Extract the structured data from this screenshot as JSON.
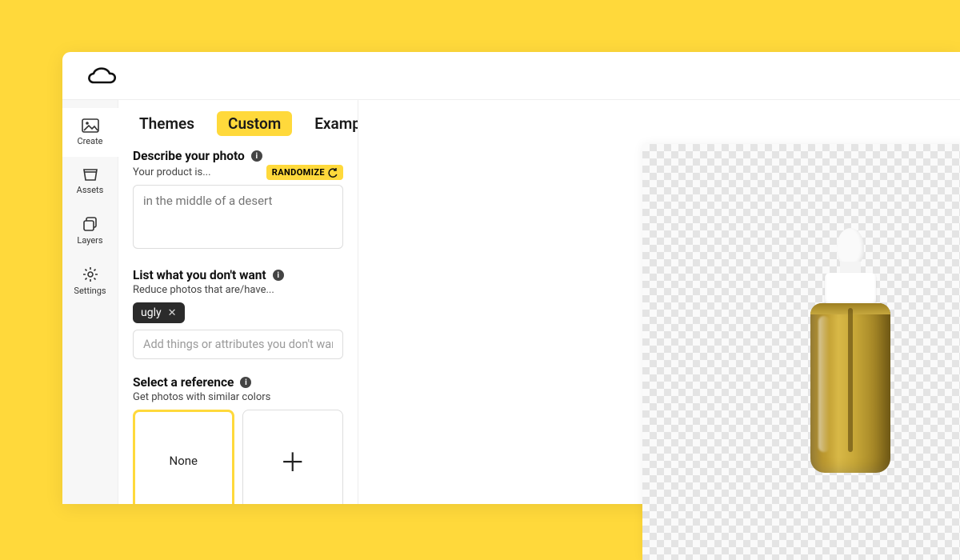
{
  "sidebar": {
    "items": [
      {
        "label": "Create"
      },
      {
        "label": "Assets"
      },
      {
        "label": "Layers"
      },
      {
        "label": "Settings"
      }
    ]
  },
  "tabs": {
    "themes": "Themes",
    "custom": "Custom",
    "examples": "Examples"
  },
  "describe": {
    "title": "Describe your photo",
    "hint": "Your product is...",
    "randomize": "RANDOMIZE",
    "placeholder": "in the middle of a desert"
  },
  "negative": {
    "title": "List what you don't want",
    "hint": "Reduce photos that are/have...",
    "chip": "ugly",
    "placeholder": "Add things or attributes you don't want"
  },
  "reference": {
    "title": "Select a reference",
    "hint": "Get photos with similar colors",
    "none": "None"
  }
}
